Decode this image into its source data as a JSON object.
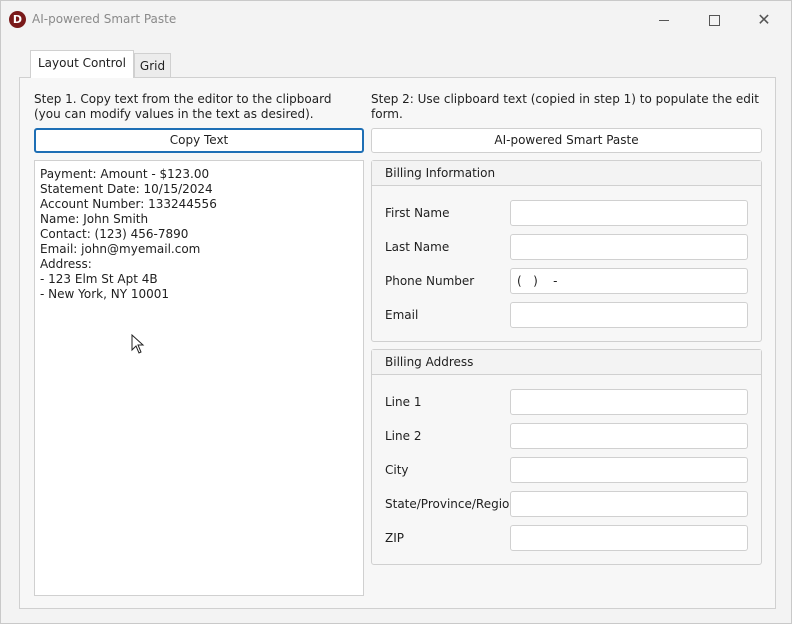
{
  "window": {
    "title": "AI-powered Smart Paste",
    "logo_letter": "D",
    "controls": {
      "minimize": "minimize",
      "maximize": "maximize",
      "close": "✕"
    }
  },
  "tabs": [
    {
      "label": "Layout Control",
      "selected": true
    },
    {
      "label": "Grid",
      "selected": false
    }
  ],
  "step1": {
    "text": "Step 1. Copy text from the editor to the clipboard (you can modify values in the text as desired).",
    "button": "Copy Text"
  },
  "step2": {
    "text": "Step 2: Use clipboard text (copied in step 1) to populate the edit form.",
    "button": "AI-powered Smart Paste"
  },
  "editor": {
    "lines": [
      "Payment: Amount - $123.00",
      "Statement Date: 10/15/2024",
      "Account Number: 133244556",
      "Name: John Smith",
      "Contact: (123) 456-7890",
      "Email: john@myemail.com",
      "Address:",
      "- 123 Elm St Apt 4B",
      "- New York, NY 10001"
    ]
  },
  "billing_information": {
    "header": "Billing Information",
    "fields": [
      {
        "label": "First Name",
        "value": ""
      },
      {
        "label": "Last Name",
        "value": ""
      },
      {
        "label": "Phone Number",
        "value": "(   )    -"
      },
      {
        "label": "Email",
        "value": ""
      }
    ]
  },
  "billing_address": {
    "header": "Billing Address",
    "fields": [
      {
        "label": "Line 1",
        "value": ""
      },
      {
        "label": "Line 2",
        "value": ""
      },
      {
        "label": "City",
        "value": ""
      },
      {
        "label": "State/Province/Region",
        "value": ""
      },
      {
        "label": "ZIP",
        "value": ""
      }
    ]
  },
  "colors": {
    "accent": "#1e6fb5",
    "logo": "#7a1a1a",
    "border": "#d0d0d0",
    "background": "#f3f3f3"
  }
}
